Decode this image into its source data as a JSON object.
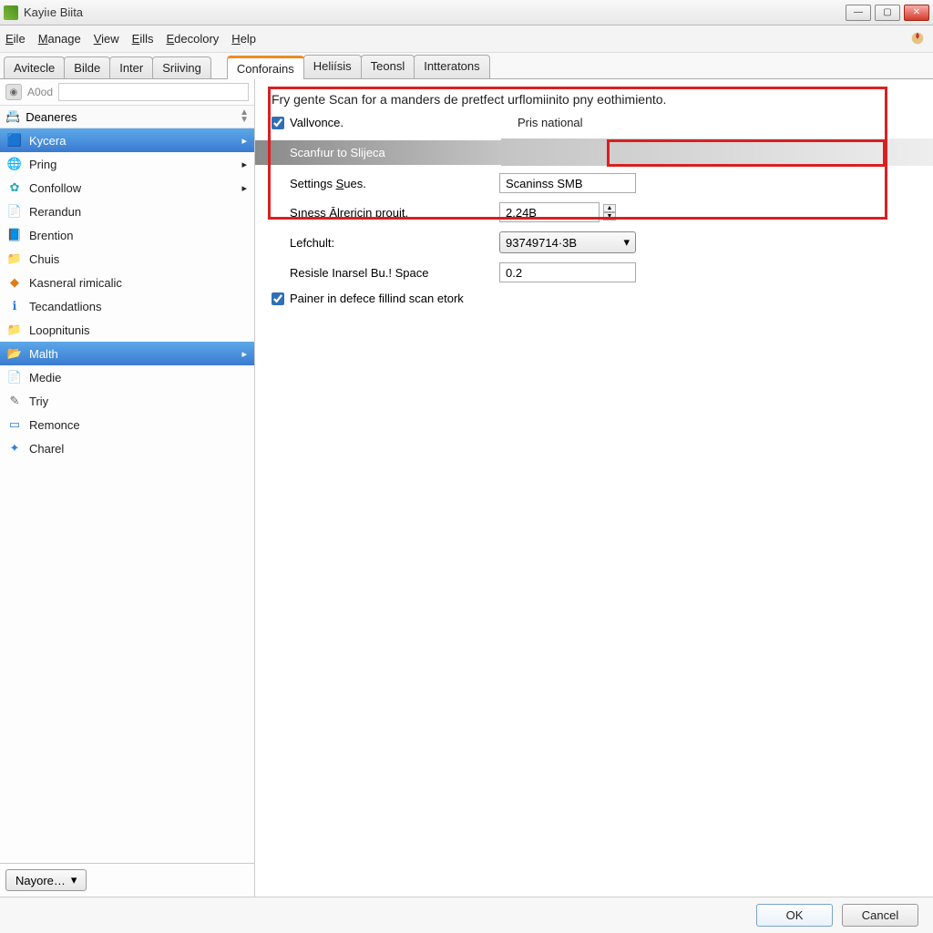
{
  "window": {
    "title": "Kayiıe Biita"
  },
  "menu": {
    "file": "Eile",
    "manage": "Manage",
    "view": "View",
    "eills": "Eills",
    "edecolory": "Edecolory",
    "help": "Help"
  },
  "outerTabs": [
    "Avitecle",
    "Bilde",
    "Inter",
    "Sriiving"
  ],
  "innerTabs": [
    "Conforains",
    "Heliísis",
    "Teonsl",
    "Intteratons"
  ],
  "activeInnerTab": 0,
  "toolbar": {
    "addLabel": "A0od",
    "searchValue": ""
  },
  "section": {
    "title": "Deaneres"
  },
  "tree": [
    {
      "label": "Kycera",
      "hasSub": true,
      "selected": true,
      "icon": "🟦",
      "cls": "blue"
    },
    {
      "label": "Pring",
      "hasSub": true,
      "icon": "🌐",
      "cls": "green"
    },
    {
      "label": "Confollow",
      "hasSub": true,
      "icon": "✿",
      "cls": "teal"
    },
    {
      "label": "Rerandun",
      "icon": "📄",
      "cls": "grey"
    },
    {
      "label": "Brention",
      "icon": "📘",
      "cls": "blue"
    },
    {
      "label": "Chuis",
      "icon": "📁",
      "cls": "gold"
    },
    {
      "label": "Kasneral rimicalic",
      "icon": "◆",
      "cls": "orange"
    },
    {
      "label": "Tecandatlions",
      "icon": "ℹ",
      "cls": "blue"
    },
    {
      "label": "Loopnitunis",
      "icon": "📁",
      "cls": "gold"
    },
    {
      "label": "Malth",
      "hasSub": true,
      "selected": true,
      "icon": "📂",
      "cls": "blue"
    },
    {
      "label": "Medie",
      "icon": "📄",
      "cls": "green"
    },
    {
      "label": "Triy",
      "icon": "✎",
      "cls": "grey"
    },
    {
      "label": "Remonce",
      "icon": "▭",
      "cls": "blue"
    },
    {
      "label": "Charel",
      "icon": "✦",
      "cls": "blue"
    }
  ],
  "sidebarFooter": {
    "label": "Nayore…"
  },
  "main": {
    "intro": "Fry gente Scan for a manders de pretfect urflomiinito pny eothimiento.",
    "vallvonce": {
      "label": "Vallvonce.",
      "checked": true,
      "right": "Pris national"
    },
    "scanfur": "Scanfıur to Slijeca",
    "settings": {
      "label": "Settings Sues.",
      "value": "Scaninss SMB"
    },
    "suness": {
      "label": "Sıness Ālrericin prouit.",
      "value": "2.24B"
    },
    "lefchult": {
      "label": "Lefchult:",
      "value": "93749714·3B"
    },
    "resisle": {
      "label": "Resisle Inarsel Bu.! Space",
      "value": "0.2"
    },
    "painer": {
      "label": "Painer in defece fillind scan etork",
      "checked": true
    }
  },
  "footer": {
    "ok": "OK",
    "cancel": "Cancel"
  }
}
